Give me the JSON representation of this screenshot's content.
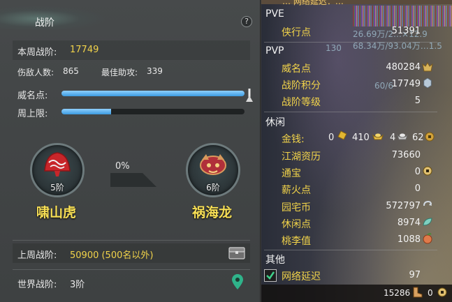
{
  "left_panel": {
    "title": "战阶",
    "help_icon": "?",
    "weekly_rank_label": "本周战阶:",
    "weekly_rank_value": "17749",
    "kills_label": "伤敌人数:",
    "kills_value": "865",
    "assist_label": "最佳助攻:",
    "assist_value": "339",
    "prestige_label": "威名点:",
    "prestige_fill": 1.0,
    "weekly_cap_label": "周上限:",
    "weekly_cap_fill": 0.27,
    "current_medal": {
      "rank": "5阶",
      "name": "啸山虎"
    },
    "next_medal": {
      "rank": "6阶",
      "name": "祸海龙"
    },
    "progress_percent": "0%",
    "last_week_label": "上周战阶:",
    "last_week_value": "50900 (500名以外)",
    "world_rank_label": "世界战阶:",
    "world_rank_value": "3阶"
  },
  "right_panel": {
    "top_strip_text": "… 网络延迟：…",
    "overlay_1": "26.69万/2…×12.9",
    "overlay_2": "68.34万/93.04万…1.5",
    "overlay_3": "130",
    "overlay_4": "60/6",
    "pve": {
      "heading": "PVE",
      "items": [
        {
          "label": "侠行点",
          "value": "51391"
        }
      ]
    },
    "pvp": {
      "heading": "PVP",
      "items": [
        {
          "label": "威名点",
          "value": "480284"
        },
        {
          "label": "战阶积分",
          "value": "17749"
        },
        {
          "label": "战阶等级",
          "value": "5"
        }
      ]
    },
    "leisure": {
      "heading": "休闲",
      "money_label": "金钱:",
      "money_gold_bars": "0",
      "money_gold": "410",
      "money_silver": "4",
      "money_copper": "62",
      "items": [
        {
          "label": "江湖资历",
          "value": "73660"
        },
        {
          "label": "通宝",
          "value": "0"
        },
        {
          "label": "薪火点",
          "value": "0"
        },
        {
          "label": "园宅币",
          "value": "572797"
        },
        {
          "label": "休闲点",
          "value": "8974"
        },
        {
          "label": "桃李值",
          "value": "1088"
        }
      ]
    },
    "other": {
      "heading": "其他",
      "latency_label": "网络延迟",
      "latency_value": "97"
    },
    "bottom": {
      "value_1": "15286",
      "value_2": "0"
    }
  }
}
